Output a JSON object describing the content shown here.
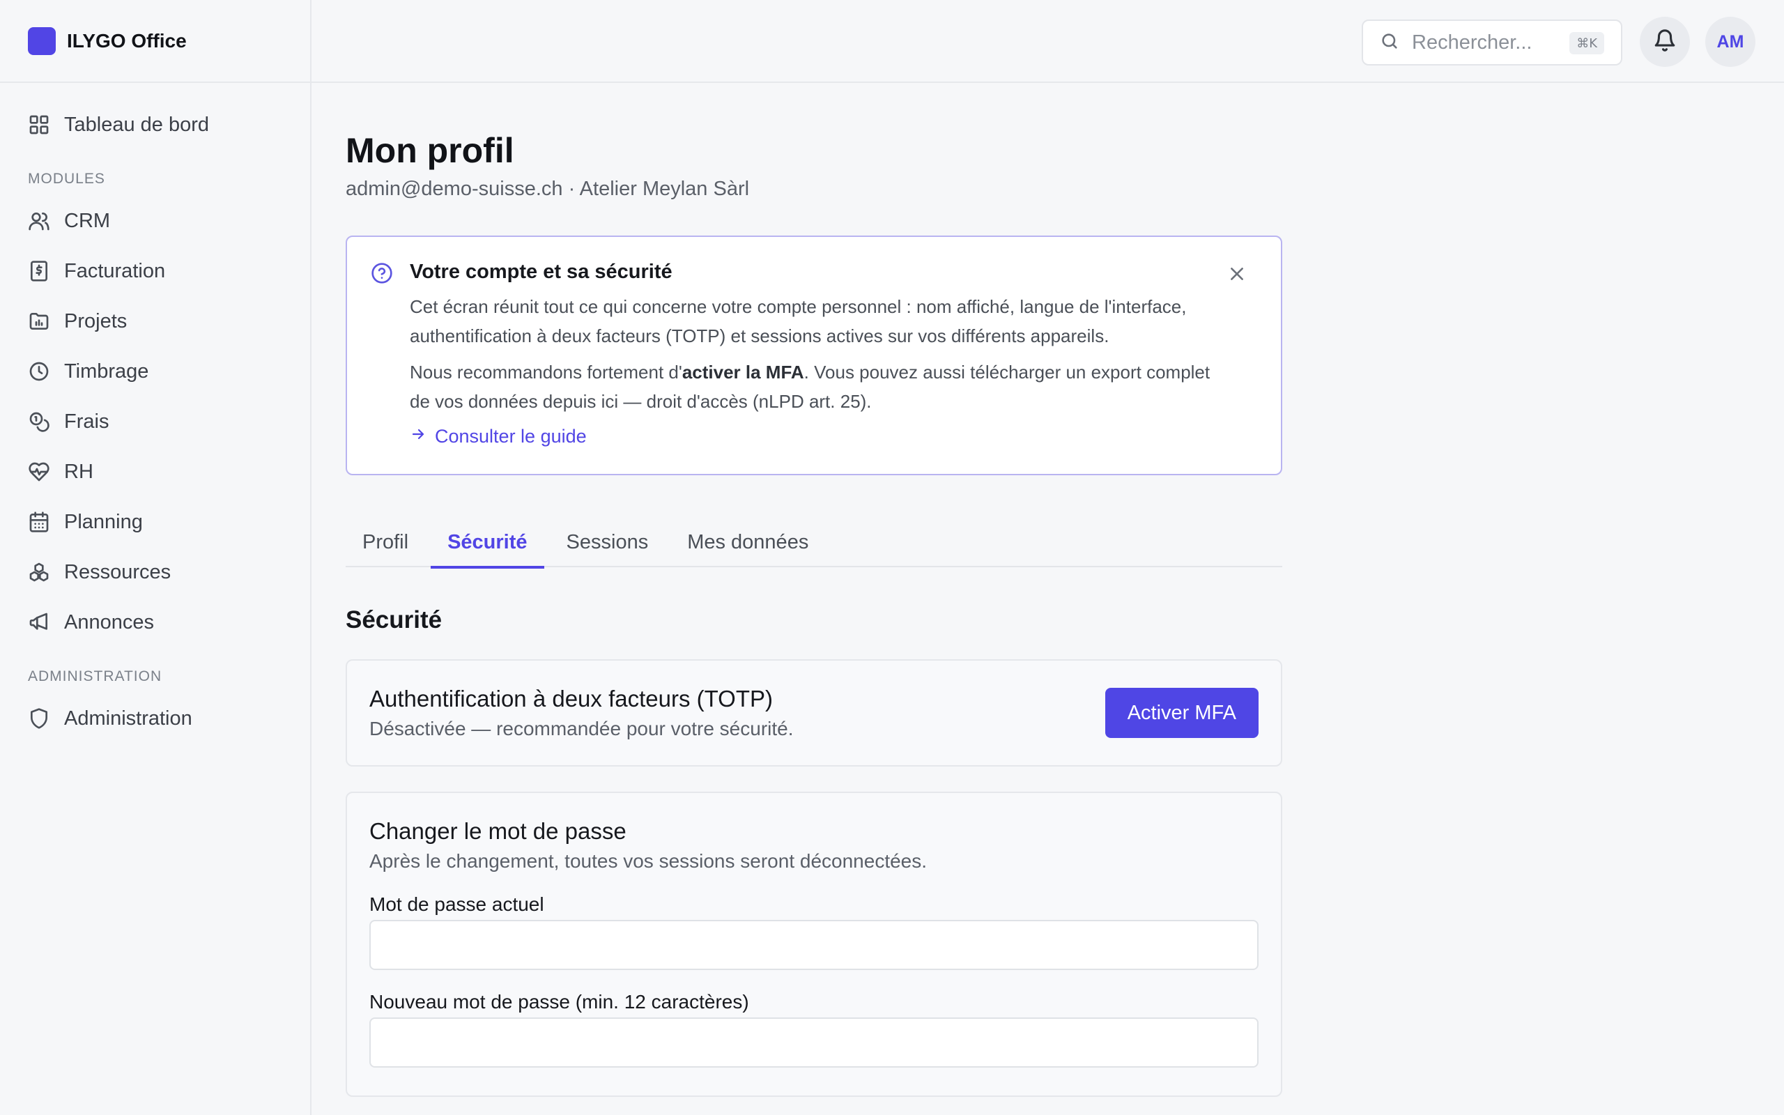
{
  "brand": {
    "name": "ILYGO Office",
    "color": "#5145e5"
  },
  "sidebar": {
    "dashboard": {
      "label": "Tableau de bord",
      "icon": "grid-icon"
    },
    "section_modules": "MODULES",
    "modules": [
      {
        "label": "CRM",
        "icon": "users-icon"
      },
      {
        "label": "Facturation",
        "icon": "invoice-icon"
      },
      {
        "label": "Projets",
        "icon": "folder-chart-icon"
      },
      {
        "label": "Timbrage",
        "icon": "clock-icon"
      },
      {
        "label": "Frais",
        "icon": "coins-icon"
      },
      {
        "label": "RH",
        "icon": "heart-pulse-icon"
      },
      {
        "label": "Planning",
        "icon": "calendar-icon"
      },
      {
        "label": "Ressources",
        "icon": "boxes-icon"
      },
      {
        "label": "Annonces",
        "icon": "megaphone-icon"
      }
    ],
    "section_admin": "ADMINISTRATION",
    "admin": [
      {
        "label": "Administration",
        "icon": "shield-icon"
      }
    ]
  },
  "topbar": {
    "search_placeholder": "Rechercher...",
    "search_shortcut": "⌘K",
    "avatar_initials": "AM"
  },
  "page": {
    "title": "Mon profil",
    "subtitle": "admin@demo-suisse.ch · Atelier Meylan Sàrl"
  },
  "info": {
    "title": "Votre compte et sa sécurité",
    "p1": "Cet écran réunit tout ce qui concerne votre compte personnel : nom affiché, langue de l'interface, authentification à deux facteurs (TOTP) et sessions actives sur vos différents appareils.",
    "p2_before": "Nous recommandons fortement d'",
    "p2_bold": "activer la MFA",
    "p2_after": ". Vous pouvez aussi télécharger un export complet de vos données depuis ici — droit d'accès (nLPD art. 25).",
    "link": "Consulter le guide"
  },
  "tabs": [
    {
      "label": "Profil",
      "active": false
    },
    {
      "label": "Sécurité",
      "active": true
    },
    {
      "label": "Sessions",
      "active": false
    },
    {
      "label": "Mes données",
      "active": false
    }
  ],
  "security": {
    "heading": "Sécurité",
    "mfa": {
      "title": "Authentification à deux facteurs (TOTP)",
      "status": "Désactivée — recommandée pour votre sécurité.",
      "button": "Activer MFA"
    },
    "password": {
      "title": "Changer le mot de passe",
      "desc": "Après le changement, toutes vos sessions seront déconnectées.",
      "current_label": "Mot de passe actuel",
      "current_value": "",
      "new_label": "Nouveau mot de passe (min. 12 caractères)",
      "new_value": ""
    }
  }
}
